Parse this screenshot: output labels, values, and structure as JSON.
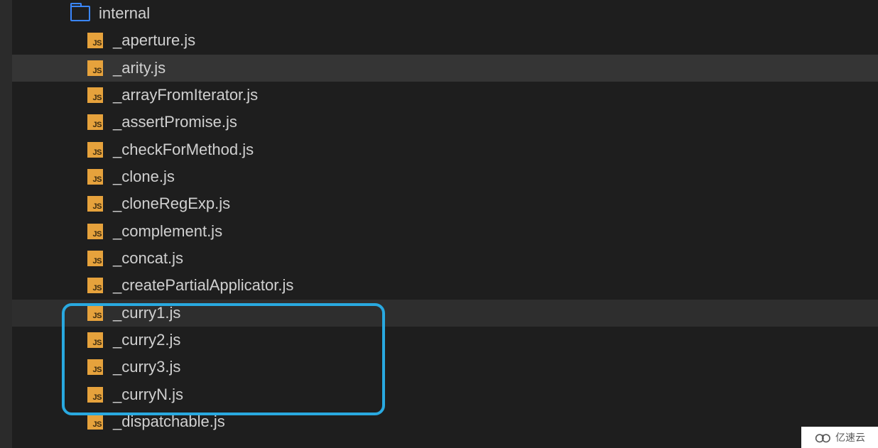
{
  "folder": {
    "name": "internal"
  },
  "files": [
    {
      "name": "_aperture.js",
      "selected": false
    },
    {
      "name": "_arity.js",
      "selected": true
    },
    {
      "name": "_arrayFromIterator.js",
      "selected": false
    },
    {
      "name": "_assertPromise.js",
      "selected": false
    },
    {
      "name": "_checkForMethod.js",
      "selected": false
    },
    {
      "name": "_clone.js",
      "selected": false
    },
    {
      "name": "_cloneRegExp.js",
      "selected": false
    },
    {
      "name": "_complement.js",
      "selected": false
    },
    {
      "name": "_concat.js",
      "selected": false
    },
    {
      "name": "_createPartialApplicator.js",
      "selected": false
    },
    {
      "name": "_curry1.js",
      "selected": false,
      "boxed": true,
      "box_first": true
    },
    {
      "name": "_curry2.js",
      "selected": false,
      "boxed": true
    },
    {
      "name": "_curry3.js",
      "selected": false,
      "boxed": true
    },
    {
      "name": "_curryN.js",
      "selected": false,
      "boxed": true
    },
    {
      "name": "_dispatchable.js",
      "selected": false
    }
  ],
  "icons": {
    "js_label": "JS"
  },
  "watermark": {
    "text": "亿速云"
  }
}
